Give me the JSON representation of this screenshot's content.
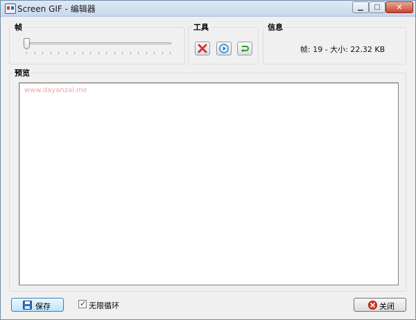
{
  "window": {
    "title": "Screen GIF - 编辑器",
    "minimize_glyph": "▁",
    "maximize_glyph": "□",
    "close_glyph": "✕"
  },
  "frames_group": {
    "label": "帧",
    "slider_position": 0,
    "tick_count": 19
  },
  "tools_group": {
    "label": "工具",
    "buttons": [
      {
        "name": "delete",
        "icon": "delete-x-icon",
        "color": "#d9332b"
      },
      {
        "name": "play",
        "icon": "play-circle-icon",
        "color": "#2d7fc8"
      },
      {
        "name": "undo",
        "icon": "undo-arrow-icon",
        "color": "#2f9a2f"
      }
    ]
  },
  "info_group": {
    "label": "信息",
    "text": "帧: 19 - 大小: 22.32 KB"
  },
  "preview_group": {
    "label": "预览",
    "watermark": "www.dayanzai.me"
  },
  "footer": {
    "save_label": "保存",
    "save_icon": "floppy-disk-icon",
    "loop_label": "无限循环",
    "loop_checked": true,
    "close_label": "关闭",
    "close_icon": "red-x-circle-icon"
  },
  "colors": {
    "window_bg": "#f0f0f0",
    "preview_bg": "#ffffff",
    "watermark": "#f0a4a8"
  }
}
